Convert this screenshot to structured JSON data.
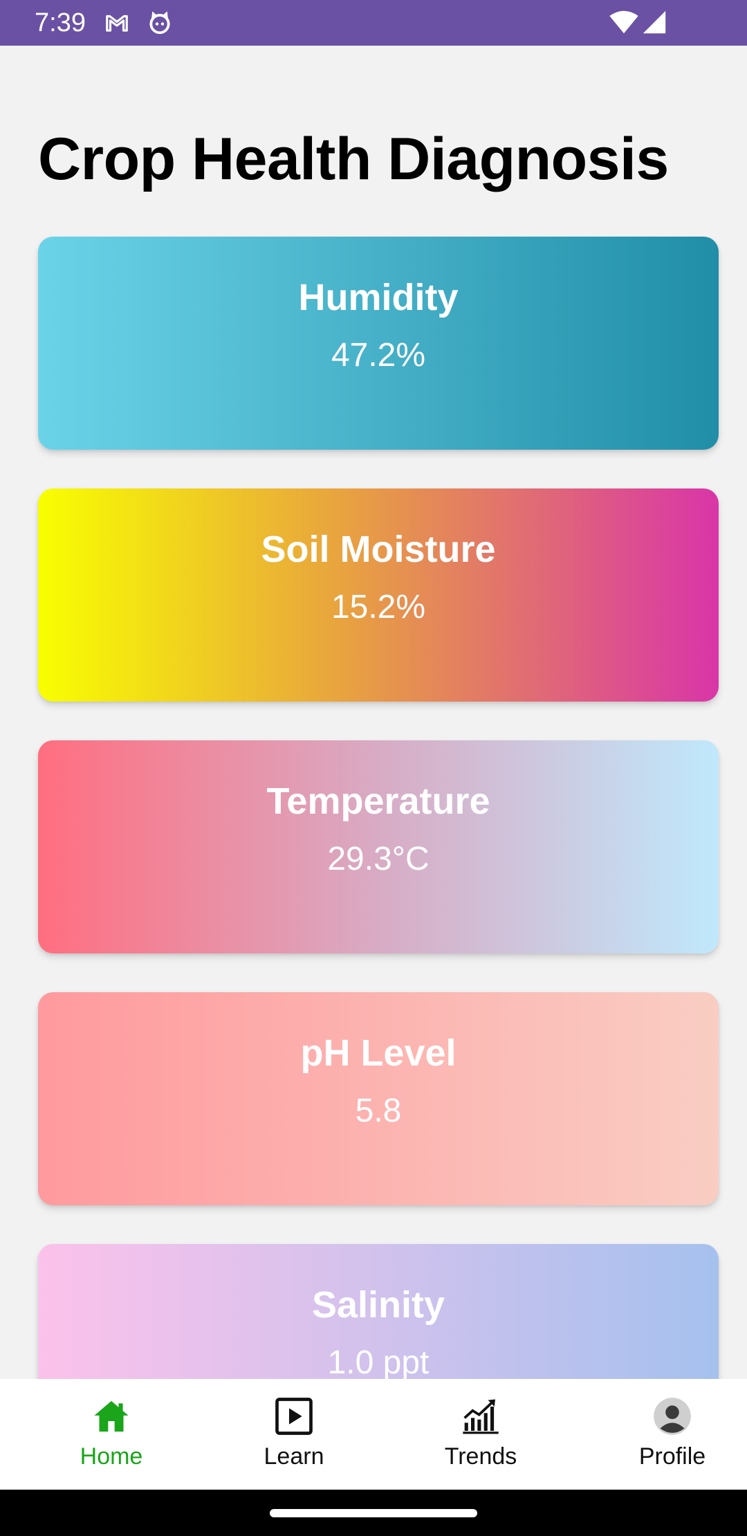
{
  "status_bar": {
    "time": "7:39",
    "left_icons": [
      "gmail-icon",
      "android-cat-icon"
    ],
    "right_icons": [
      "wifi-icon",
      "signal-icon"
    ],
    "background_color": "#6a51a3"
  },
  "page": {
    "title": "Crop Health Diagnosis"
  },
  "cards": [
    {
      "title": "Humidity",
      "value": "47.2%",
      "gradient": [
        "#6bd3e8",
        "#218ea8"
      ]
    },
    {
      "title": "Soil Moisture",
      "value": "15.2%",
      "gradient": [
        "#f8ff00",
        "#d935a8"
      ]
    },
    {
      "title": "Temperature",
      "value": "29.3°C",
      "gradient": [
        "#ff6e80",
        "#c0e8fc"
      ]
    },
    {
      "title": "pH Level",
      "value": "5.8",
      "gradient": [
        "#ff9a9e",
        "#f9cdc3"
      ]
    },
    {
      "title": "Salinity",
      "value": "1.0 ppt",
      "gradient": [
        "#fbc2eb",
        "#a6c1ee"
      ]
    }
  ],
  "bottom_nav": {
    "items": [
      {
        "label": "Home",
        "icon": "home-icon",
        "active": true
      },
      {
        "label": "Learn",
        "icon": "play-icon",
        "active": false
      },
      {
        "label": "Trends",
        "icon": "trend-chart-icon",
        "active": false
      },
      {
        "label": "Profile",
        "icon": "profile-icon",
        "active": false
      }
    ],
    "active_color": "#1aa51a"
  }
}
